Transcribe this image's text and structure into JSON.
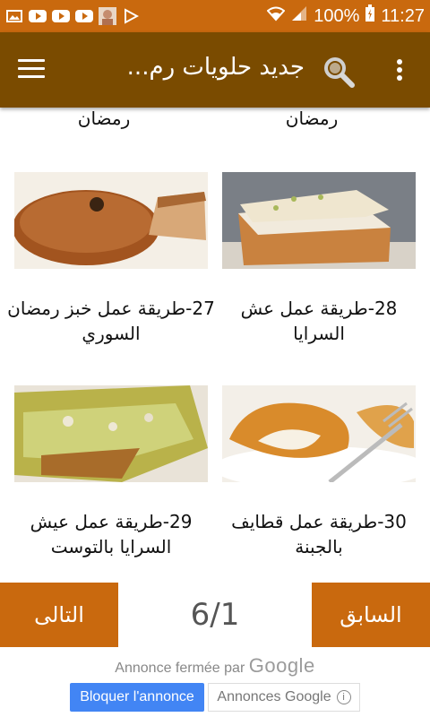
{
  "status_bar": {
    "battery": "100%",
    "time": "11:27"
  },
  "app_bar": {
    "title": "جديد حلويات رم..."
  },
  "list": {
    "previous_row_captions": [
      "رمضان",
      "رمضان"
    ],
    "items": [
      {
        "caption": "28-طريقة عمل عش السرايا",
        "image_icon": "cake-slice-photo"
      },
      {
        "caption": "27-طريقة عمل خبز رمضان السوري",
        "image_icon": "bread-photo"
      },
      {
        "caption": "30-طريقة عمل قطايف بالجبنة",
        "image_icon": "qatayef-photo"
      },
      {
        "caption": "29-طريقة عمل عيش السرايا بالتوست",
        "image_icon": "pistachio-dessert-photo"
      }
    ]
  },
  "pager": {
    "next_label": "التالى",
    "prev_label": "السابق",
    "page_indicator": "6/1"
  },
  "ad": {
    "closed_text": "Annonce fermée par",
    "closed_brand": "Google",
    "block_label": "Bloquer l'annonce",
    "google_ads_label": "Annonces Google"
  },
  "colors": {
    "status_bar": "#c9690e",
    "app_bar": "#7a4b00",
    "pager_button": "#c9690e",
    "ad_button": "#4285f4"
  }
}
